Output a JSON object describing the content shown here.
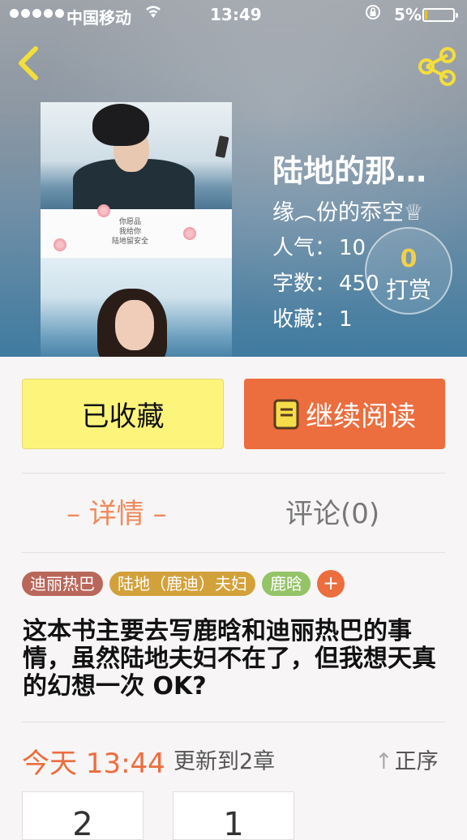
{
  "status_bar": {
    "carrier": "中国移动",
    "time": "13:49",
    "battery": "5%",
    "battery_level": 0.05
  },
  "nav": {
    "back_icon": "chevron-left-icon",
    "share_icon": "share-icon"
  },
  "book": {
    "title": "陆地的那…",
    "author": "缘︵份的忝空♕",
    "cover_poem": [
      "你愿品",
      "我给你",
      "陆地留安全"
    ],
    "stats": [
      {
        "label": "人气：",
        "value": "10"
      },
      {
        "label": "字数：",
        "value": "450"
      },
      {
        "label": "收藏：",
        "value": "1"
      }
    ],
    "reward": {
      "count": "0",
      "label": "打赏"
    }
  },
  "actions": {
    "favorite_label": "已收藏",
    "continue_label": "继续阅读"
  },
  "tabs": {
    "detail": "– 详情 –",
    "comments": "评论(0)"
  },
  "tags": [
    {
      "label": "迪丽热巴",
      "color": "#b9675a"
    },
    {
      "label": "陆地（鹿迪）夫妇",
      "color": "#d3a13a"
    },
    {
      "label": "鹿晗",
      "color": "#95c367"
    }
  ],
  "tag_add_label": "+",
  "description": "这本书主要去写鹿晗和迪丽热巴的事情，虽然陆地夫妇不在了，但我想天真的幻想一次 OK?",
  "update": {
    "today": "今天 13:44",
    "text": "更新到2章",
    "order_label": "正序"
  },
  "chapters": [
    "2",
    "1"
  ],
  "colors": {
    "accent": "#ec6d3e",
    "favorite_bg": "#fdf47b",
    "tab_active": "#ef8a5c"
  }
}
